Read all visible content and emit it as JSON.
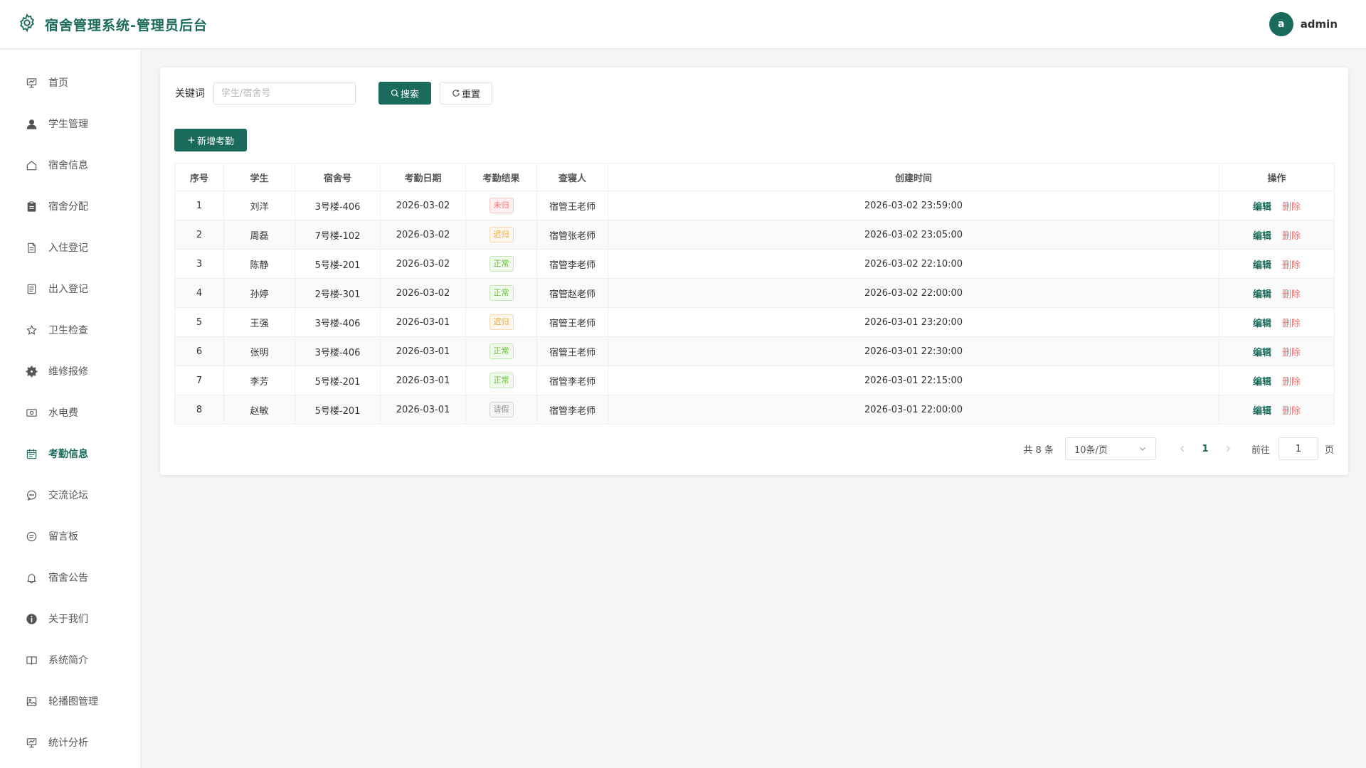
{
  "header": {
    "title": "宿舍管理系统-管理员后台",
    "avatar_letter": "a",
    "username": "admin"
  },
  "colors": {
    "brand": "#1a6b5b",
    "danger": "#f56c6c",
    "warning": "#e6a23c",
    "success": "#67c23a",
    "info": "#909399"
  },
  "sidebar": {
    "active_index": 9,
    "items": [
      {
        "label": "首页",
        "icon": "dashboard-icon"
      },
      {
        "label": "学生管理",
        "icon": "user-icon"
      },
      {
        "label": "宿舍信息",
        "icon": "home-icon"
      },
      {
        "label": "宿舍分配",
        "icon": "clipboard-icon"
      },
      {
        "label": "入住登记",
        "icon": "document-icon"
      },
      {
        "label": "出入登记",
        "icon": "list-icon"
      },
      {
        "label": "卫生检查",
        "icon": "star-icon"
      },
      {
        "label": "维修报修",
        "icon": "settings-icon"
      },
      {
        "label": "水电费",
        "icon": "money-icon"
      },
      {
        "label": "考勤信息",
        "icon": "calendar-icon"
      },
      {
        "label": "交流论坛",
        "icon": "chat-icon"
      },
      {
        "label": "留言板",
        "icon": "message-icon"
      },
      {
        "label": "宿舍公告",
        "icon": "bell-icon"
      },
      {
        "label": "关于我们",
        "icon": "info-icon"
      },
      {
        "label": "系统简介",
        "icon": "book-icon"
      },
      {
        "label": "轮播图管理",
        "icon": "picture-icon"
      },
      {
        "label": "统计分析",
        "icon": "chart-icon"
      }
    ]
  },
  "search": {
    "label": "关键词",
    "placeholder": "学生/宿舍号",
    "value": "",
    "search_label": "搜索",
    "reset_label": "重置"
  },
  "toolbar": {
    "add_label": "新增考勤"
  },
  "table": {
    "columns": [
      "序号",
      "学生",
      "宿舍号",
      "考勤日期",
      "考勤结果",
      "查寝人",
      "创建时间",
      "操作"
    ],
    "edit_label": "编辑",
    "delete_label": "删除",
    "rows": [
      {
        "no": "1",
        "student": "刘洋",
        "room": "3号楼-406",
        "date": "2026-03-02",
        "result": "未归",
        "status": "danger",
        "inspector": "宿管王老师",
        "created": "2026-03-02 23:59:00"
      },
      {
        "no": "2",
        "student": "周磊",
        "room": "7号楼-102",
        "date": "2026-03-02",
        "result": "迟归",
        "status": "warning",
        "inspector": "宿管张老师",
        "created": "2026-03-02 23:05:00"
      },
      {
        "no": "3",
        "student": "陈静",
        "room": "5号楼-201",
        "date": "2026-03-02",
        "result": "正常",
        "status": "success",
        "inspector": "宿管李老师",
        "created": "2026-03-02 22:10:00"
      },
      {
        "no": "4",
        "student": "孙婷",
        "room": "2号楼-301",
        "date": "2026-03-02",
        "result": "正常",
        "status": "success",
        "inspector": "宿管赵老师",
        "created": "2026-03-02 22:00:00"
      },
      {
        "no": "5",
        "student": "王强",
        "room": "3号楼-406",
        "date": "2026-03-01",
        "result": "迟归",
        "status": "warning",
        "inspector": "宿管王老师",
        "created": "2026-03-01 23:20:00"
      },
      {
        "no": "6",
        "student": "张明",
        "room": "3号楼-406",
        "date": "2026-03-01",
        "result": "正常",
        "status": "success",
        "inspector": "宿管王老师",
        "created": "2026-03-01 22:30:00"
      },
      {
        "no": "7",
        "student": "李芳",
        "room": "5号楼-201",
        "date": "2026-03-01",
        "result": "正常",
        "status": "success",
        "inspector": "宿管李老师",
        "created": "2026-03-01 22:15:00"
      },
      {
        "no": "8",
        "student": "赵敏",
        "room": "5号楼-201",
        "date": "2026-03-01",
        "result": "请假",
        "status": "info",
        "inspector": "宿管李老师",
        "created": "2026-03-01 22:00:00"
      }
    ]
  },
  "pagination": {
    "total_label": "共 8 条",
    "page_size": "10条/页",
    "current_page": "1",
    "goto_label": "前往",
    "goto_value": "1",
    "goto_suffix": "页"
  }
}
